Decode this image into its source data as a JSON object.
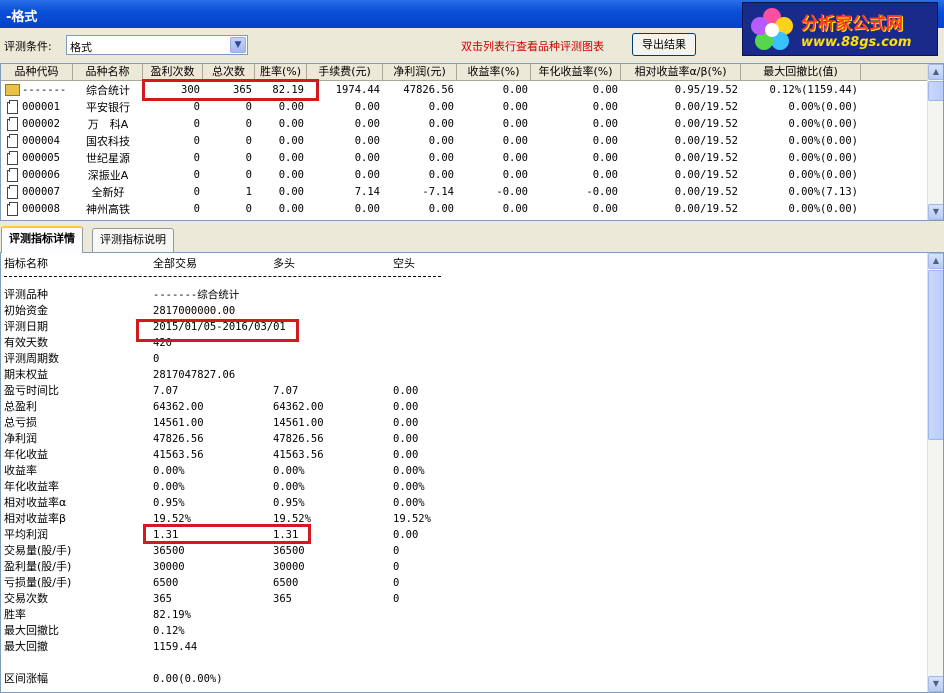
{
  "window": {
    "title": "-格式"
  },
  "logo": {
    "brand": "分析家公式网",
    "url": "www.88gs.com"
  },
  "filter": {
    "label": "评测条件:",
    "value": "格式",
    "hint": "双击列表行查看品种评测图表",
    "export_label": "导出结果"
  },
  "table": {
    "columns": [
      "品种代码",
      "品种名称",
      "盈利次数",
      "总次数",
      "胜率(%)",
      "手续费(元)",
      "净利润(元)",
      "收益率(%)",
      "年化收益率(%)",
      "相对收益率α/β(%)",
      "最大回撤比(值)"
    ],
    "rows": [
      [
        "-------",
        "综合统计",
        "300",
        "365",
        "82.19",
        "1974.44",
        "47826.56",
        "0.00",
        "0.00",
        "0.95/19.52",
        "0.12%(1159.44)"
      ],
      [
        "000001",
        "平安银行",
        "0",
        "0",
        "0.00",
        "0.00",
        "0.00",
        "0.00",
        "0.00",
        "0.00/19.52",
        "0.00%(0.00)"
      ],
      [
        "000002",
        "万　科A",
        "0",
        "0",
        "0.00",
        "0.00",
        "0.00",
        "0.00",
        "0.00",
        "0.00/19.52",
        "0.00%(0.00)"
      ],
      [
        "000004",
        "国农科技",
        "0",
        "0",
        "0.00",
        "0.00",
        "0.00",
        "0.00",
        "0.00",
        "0.00/19.52",
        "0.00%(0.00)"
      ],
      [
        "000005",
        "世纪星源",
        "0",
        "0",
        "0.00",
        "0.00",
        "0.00",
        "0.00",
        "0.00",
        "0.00/19.52",
        "0.00%(0.00)"
      ],
      [
        "000006",
        "深振业A",
        "0",
        "0",
        "0.00",
        "0.00",
        "0.00",
        "0.00",
        "0.00",
        "0.00/19.52",
        "0.00%(0.00)"
      ],
      [
        "000007",
        "全新好",
        "0",
        "1",
        "0.00",
        "7.14",
        "-7.14",
        "-0.00",
        "-0.00",
        "0.00/19.52",
        "0.00%(7.13)"
      ],
      [
        "000008",
        "神州高铁",
        "0",
        "0",
        "0.00",
        "0.00",
        "0.00",
        "0.00",
        "0.00",
        "0.00/19.52",
        "0.00%(0.00)"
      ]
    ]
  },
  "tabs": [
    "评测指标详情",
    "评测指标说明"
  ],
  "detail": {
    "headers": [
      "指标名称",
      "全部交易",
      "多头",
      "空头"
    ],
    "rows": [
      [
        "评测品种",
        "-------综合统计",
        "",
        ""
      ],
      [
        "初始资金",
        "2817000000.00",
        "",
        ""
      ],
      [
        "评测日期",
        "2015/01/05-2016/03/01",
        "",
        ""
      ],
      [
        "有效天数",
        "420",
        "",
        ""
      ],
      [
        "评测周期数",
        "0",
        "",
        ""
      ],
      [
        "期末权益",
        "2817047827.06",
        "",
        ""
      ],
      [
        "盈亏时间比",
        "7.07",
        "7.07",
        "0.00"
      ],
      [
        "总盈利",
        "64362.00",
        "64362.00",
        "0.00"
      ],
      [
        "总亏损",
        "14561.00",
        "14561.00",
        "0.00"
      ],
      [
        "净利润",
        "47826.56",
        "47826.56",
        "0.00"
      ],
      [
        "年化收益",
        "41563.56",
        "41563.56",
        "0.00"
      ],
      [
        "收益率",
        "0.00%",
        "0.00%",
        "0.00%"
      ],
      [
        "年化收益率",
        "0.00%",
        "0.00%",
        "0.00%"
      ],
      [
        "相对收益率α",
        "0.95%",
        "0.95%",
        "0.00%"
      ],
      [
        "相对收益率β",
        "19.52%",
        "19.52%",
        "19.52%"
      ],
      [
        "平均利润",
        "1.31",
        "1.31",
        "0.00"
      ],
      [
        "交易量(股/手)",
        "36500",
        "36500",
        "0"
      ],
      [
        "盈利量(股/手)",
        "30000",
        "30000",
        "0"
      ],
      [
        "亏损量(股/手)",
        "6500",
        "6500",
        "0"
      ],
      [
        "交易次数",
        "365",
        "365",
        "0"
      ],
      [
        "胜率",
        "82.19%",
        "",
        ""
      ],
      [
        "最大回撤比",
        "0.12%",
        "",
        ""
      ],
      [
        "最大回撤",
        "1159.44",
        "",
        ""
      ],
      [
        "",
        "",
        "",
        ""
      ],
      [
        "区间涨幅",
        "0.00(0.00%)",
        "",
        ""
      ]
    ]
  },
  "colors": {
    "title_bar": "#0a4fd8",
    "hint": "#cc0000",
    "highlight_box": "#d2191f"
  },
  "icons": {
    "summary_row": "folder-icon",
    "stock_row": "page-icon"
  }
}
